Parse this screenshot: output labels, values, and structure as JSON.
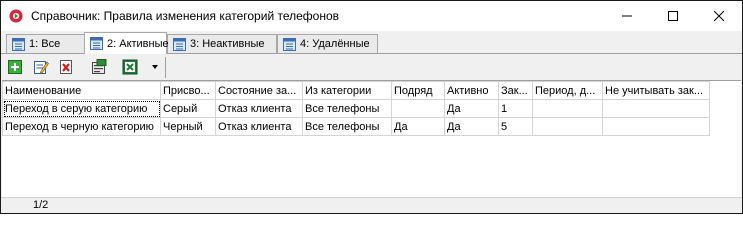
{
  "window": {
    "title": "Справочник: Правила изменения категорий телефонов",
    "icon": "app-red-circle-icon",
    "controls": [
      "minimize-icon",
      "maximize-icon",
      "close-icon"
    ]
  },
  "tabs": [
    {
      "label": "1: Все",
      "active": false
    },
    {
      "label": "2: Активные",
      "active": true
    },
    {
      "label": "3: Неактивные",
      "active": false
    },
    {
      "label": "4: Удалённые",
      "active": false
    }
  ],
  "toolbar": {
    "buttons": [
      "add-icon",
      "edit-icon",
      "delete-icon",
      "properties-icon",
      "excel-export-icon",
      "dropdown-arrow-icon"
    ]
  },
  "grid": {
    "columns": [
      "Наименование",
      "Присво...",
      "Состояние за...",
      "Из категории",
      "Подряд",
      "Активно",
      "Зак...",
      "Период, д...",
      "Не учитывать зак..."
    ],
    "rows": [
      [
        "Переход в серую категорию",
        "Серый",
        "Отказ клиента",
        "Все телефоны",
        "",
        "Да",
        "1",
        "",
        ""
      ],
      [
        "Переход в черную категорию",
        "Черный",
        "Отказ клиента",
        "Все телефоны",
        "Да",
        "Да",
        "5",
        "",
        ""
      ]
    ]
  },
  "status": {
    "page": "1/2"
  },
  "colors": {
    "titlebar_bg": "#ffffff",
    "chrome_bg": "#f0f0f0",
    "grid_bg": "#ffffff",
    "app_icon_red": "#d9232e"
  }
}
